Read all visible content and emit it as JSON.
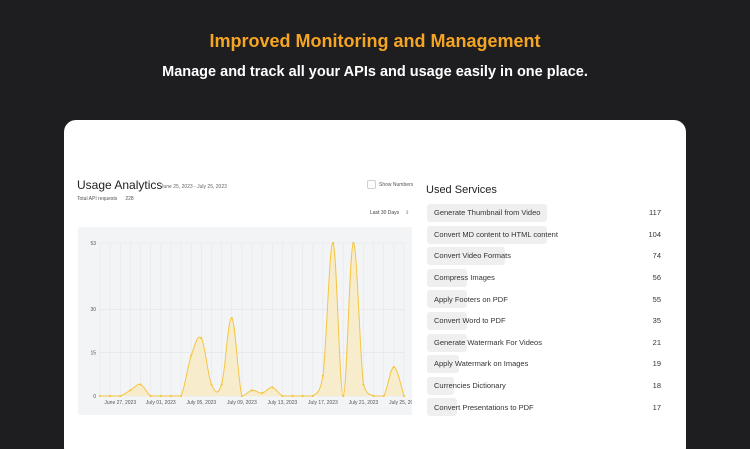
{
  "header": {
    "headline": "Improved Monitoring and Management",
    "subheadline": "Manage and track all your APIs and usage easily in one place."
  },
  "analytics": {
    "title": "Usage Analytics",
    "date_range": "June 25, 2023 - July 25, 2023",
    "total_label": "Total API requests",
    "total_value": "228",
    "show_numbers_label": "Show Numbers",
    "period_label": "Last 30 Days"
  },
  "services": {
    "title": "Used Services",
    "items": [
      {
        "name": "Generate Thumbnail from Video",
        "count": 117
      },
      {
        "name": "Convert MD content to HTML content",
        "count": 104
      },
      {
        "name": "Convert Video Formats",
        "count": 74
      },
      {
        "name": "Compress Images",
        "count": 56
      },
      {
        "name": "Apply Footers on PDF",
        "count": 55
      },
      {
        "name": "Convert Word to PDF",
        "count": 35
      },
      {
        "name": "Generate Watermark For Videos",
        "count": 21
      },
      {
        "name": "Apply Watermark on Images",
        "count": 19
      },
      {
        "name": "Currencies Dictionary",
        "count": 18
      },
      {
        "name": "Convert Presentations to PDF",
        "count": 17
      }
    ]
  },
  "chart_data": {
    "type": "area",
    "x": [
      0,
      1,
      2,
      3,
      4,
      5,
      6,
      7,
      8,
      9,
      10,
      11,
      12,
      13,
      14,
      15,
      16,
      17,
      18,
      19,
      20,
      21,
      22,
      23,
      24,
      25,
      26,
      27,
      28,
      29,
      30
    ],
    "x_tick_labels": [
      "June 27, 2023",
      "July 01, 2023",
      "July 05, 2023",
      "July 09, 2023",
      "July 13, 2023",
      "July 17, 2023",
      "July 21, 2023",
      "July 25, 2023"
    ],
    "x_tick_positions": [
      2,
      6,
      10,
      14,
      18,
      22,
      26,
      30
    ],
    "y_ticks": [
      "0",
      "15",
      "30",
      "53"
    ],
    "y_tick_values": [
      0,
      15,
      30,
      53
    ],
    "series": [
      {
        "values": [
          0,
          0,
          0,
          2,
          4,
          0,
          0,
          0,
          0,
          14,
          20,
          4,
          4,
          27,
          0,
          2,
          1,
          3,
          0,
          0,
          0,
          0,
          7,
          53,
          0,
          53,
          4,
          0,
          0,
          10,
          0
        ]
      }
    ],
    "ylim": [
      0,
      53
    ],
    "line_color": "#f5c542",
    "fill_color": "#f7ecc8",
    "grid": true
  }
}
